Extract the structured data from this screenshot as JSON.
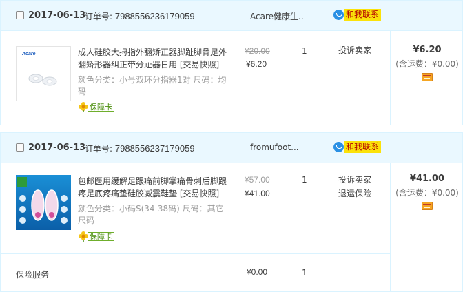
{
  "orders": [
    {
      "date": "2017-06-13",
      "order_no_label": "订单号:",
      "order_no": "7988556236179059",
      "shop": "Acare健康生..",
      "contact": "和我联系",
      "items": [
        {
          "title": "成人硅胶大拇指外翻矫正器脚趾脚骨足外翻矫形器纠正带分趾器日用",
          "tag": "[交易快照]",
          "spec": "颜色分类：小号双环分指器1对  尺码：均码",
          "guarantee": "保障卡",
          "price_old": "¥20.00",
          "price_now": "¥6.20",
          "qty": "1",
          "actions": [
            "投诉卖家"
          ],
          "thumb_brand": "Acare"
        }
      ],
      "total": "¥6.20",
      "shipping": "(含运费：¥0.00)"
    },
    {
      "date": "2017-06-13",
      "order_no_label": "订单号:",
      "order_no": "7988556237179059",
      "shop": "fromufoot...",
      "contact": "和我联系",
      "items": [
        {
          "title": "包邮医用缓解足跟痛前脚掌痛骨刺后脚跟疼足底疼痛垫硅胶减震鞋垫",
          "tag": "[交易快照]",
          "spec": "颜色分类：小码S(34-38码)  尺码：其它尺码",
          "guarantee": "保障卡",
          "price_old": "¥57.00",
          "price_now": "¥41.00",
          "qty": "1",
          "actions": [
            "投诉卖家",
            "退运保险"
          ]
        }
      ],
      "insurance": {
        "label": "保险服务",
        "price": "¥0.00",
        "qty": "1"
      },
      "total": "¥41.00",
      "shipping": "(含运费：¥0.00)"
    }
  ],
  "colors": {
    "header_bg": "#eaf8ff",
    "border": "#daf3ff",
    "contact_bg": "#fbe20a",
    "contact_text": "#b30000",
    "guarantee_green": "#4b8e0e"
  },
  "icons": [
    "wangwang-chat-icon",
    "flower-guarantee-icon",
    "credit-card-icon"
  ]
}
